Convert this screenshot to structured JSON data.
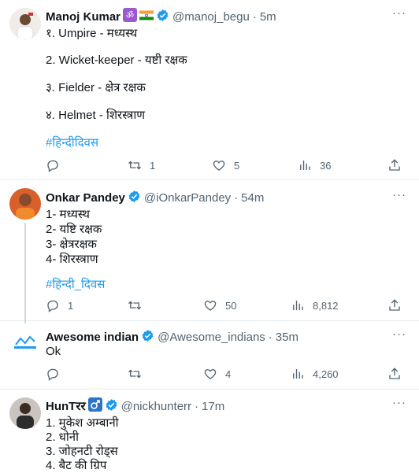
{
  "tweets": [
    {
      "name": "Manoj Kumar",
      "handle": "@manoj_begu",
      "time": "5m",
      "lines": [
        "१. Umpire -  मध्यस्थ",
        "2. Wicket-keeper - यष्टी रक्षक",
        "३. Fielder -   क्षेत्र रक्षक",
        "४. Helmet - शिरस्त्राण"
      ],
      "hashtag": "#हिन्दीदिवस",
      "replies": "",
      "retweets": "1",
      "likes": "5",
      "views": "36"
    },
    {
      "name": "Onkar Pandey",
      "handle": "@iOnkarPandey",
      "time": "54m",
      "lines": [
        "1- मध्यस्थ",
        "2- यष्टि रक्षक",
        "3- क्षेत्ररक्षक",
        "4- शिरस्त्राण"
      ],
      "hashtag": "#हिन्दी_दिवस",
      "replies": "1",
      "retweets": "",
      "likes": "50",
      "views": "8,812"
    },
    {
      "name": "Awesome indian",
      "handle": "@Awesome_indians",
      "time": "35m",
      "lines": [
        "Ok"
      ],
      "replies": "",
      "retweets": "",
      "likes": "4",
      "views": "4,260"
    },
    {
      "name": "HunTरर",
      "handle": "@nickhunterr",
      "time": "17m",
      "lines": [
        "1. मुकेश अम्बानी",
        "2. धोनी",
        "3. जोहनटी रोड्स",
        "4. बैट की ग्रिप"
      ]
    }
  ],
  "icons": {
    "reply": "reply-icon",
    "retweet": "retweet-icon",
    "like": "heart-icon",
    "views": "views-icon",
    "share": "share-icon",
    "verified": "verified-icon"
  },
  "colors": {
    "link": "#1d9bf0",
    "muted": "#536471",
    "verified": "#1d9bf0",
    "divider": "#e6ecf0"
  }
}
